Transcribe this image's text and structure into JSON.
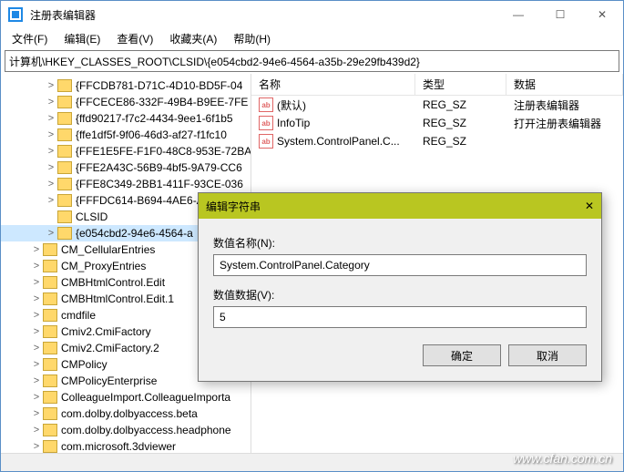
{
  "window": {
    "title": "注册表编辑器"
  },
  "menu": {
    "file": "文件(F)",
    "edit": "编辑(E)",
    "view": "查看(V)",
    "fav": "收藏夹(A)",
    "help": "帮助(H)"
  },
  "address": "计算机\\HKEY_CLASSES_ROOT\\CLSID\\{e054cbd2-94e6-4564-a35b-29e29fb439d2}",
  "tree": [
    {
      "ind": 48,
      "tw": ">",
      "label": "{FFCDB781-D71C-4D10-BD5F-04"
    },
    {
      "ind": 48,
      "tw": ">",
      "label": "{FFCECE86-332F-49B4-B9EE-7FE"
    },
    {
      "ind": 48,
      "tw": ">",
      "label": "{ffd90217-f7c2-4434-9ee1-6f1b5"
    },
    {
      "ind": 48,
      "tw": ">",
      "label": "{ffe1df5f-9f06-46d3-af27-f1fc10"
    },
    {
      "ind": 48,
      "tw": ">",
      "label": "{FFE1E5FE-F1F0-48C8-953E-72BA"
    },
    {
      "ind": 48,
      "tw": ">",
      "label": "{FFE2A43C-56B9-4bf5-9A79-CC6"
    },
    {
      "ind": 48,
      "tw": ">",
      "label": "{FFE8C349-2BB1-411F-93CE-036"
    },
    {
      "ind": 48,
      "tw": ">",
      "label": "{FFFDC614-B694-4AE6-A"
    },
    {
      "ind": 48,
      "tw": "",
      "label": "CLSID"
    },
    {
      "ind": 48,
      "tw": ">",
      "label": "{e054cbd2-94e6-4564-a",
      "sel": true
    },
    {
      "ind": 32,
      "tw": ">",
      "label": "CM_CellularEntries"
    },
    {
      "ind": 32,
      "tw": ">",
      "label": "CM_ProxyEntries"
    },
    {
      "ind": 32,
      "tw": ">",
      "label": "CMBHtmlControl.Edit"
    },
    {
      "ind": 32,
      "tw": ">",
      "label": "CMBHtmlControl.Edit.1"
    },
    {
      "ind": 32,
      "tw": ">",
      "label": "cmdfile"
    },
    {
      "ind": 32,
      "tw": ">",
      "label": "Cmiv2.CmiFactory"
    },
    {
      "ind": 32,
      "tw": ">",
      "label": "Cmiv2.CmiFactory.2"
    },
    {
      "ind": 32,
      "tw": ">",
      "label": "CMPolicy"
    },
    {
      "ind": 32,
      "tw": ">",
      "label": "CMPolicyEnterprise"
    },
    {
      "ind": 32,
      "tw": ">",
      "label": "ColleagueImport.ColleagueImporta"
    },
    {
      "ind": 32,
      "tw": ">",
      "label": "com.dolby.dolbyaccess.beta"
    },
    {
      "ind": 32,
      "tw": ">",
      "label": "com.dolby.dolbyaccess.headphone"
    },
    {
      "ind": 32,
      "tw": ">",
      "label": "com.microsoft.3dviewer"
    }
  ],
  "columns": {
    "name": "名称",
    "type": "类型",
    "data": "数据"
  },
  "values": [
    {
      "name": "(默认)",
      "type": "REG_SZ",
      "data": "注册表编辑器"
    },
    {
      "name": "InfoTip",
      "type": "REG_SZ",
      "data": "打开注册表编辑器"
    },
    {
      "name": "System.ControlPanel.C...",
      "type": "REG_SZ",
      "data": ""
    }
  ],
  "dialog": {
    "title": "编辑字符串",
    "name_label": "数值名称(N):",
    "name_value": "System.ControlPanel.Category",
    "data_label": "数值数据(V):",
    "data_value": "5",
    "ok": "确定",
    "cancel": "取消"
  },
  "watermark": "www.cfan.com.cn"
}
